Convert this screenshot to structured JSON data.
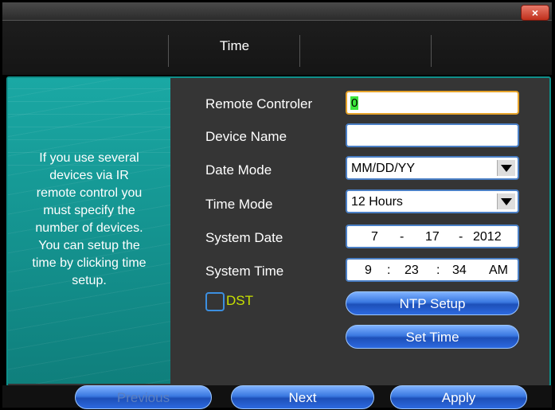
{
  "window": {
    "close_label": "×"
  },
  "tabs": [
    {
      "label": ""
    },
    {
      "label": "Time"
    },
    {
      "label": ""
    },
    {
      "label": ""
    }
  ],
  "help_text": "If you use several\ndevices via IR\nremote control you\nmust specify the\nnumber of devices.\nYou can setup the\ntime by clicking time\nsetup.",
  "fields": {
    "remote_controler": {
      "label": "Remote Controler",
      "value": "0"
    },
    "device_name": {
      "label": "Device Name",
      "value": ""
    },
    "date_mode": {
      "label": "Date Mode",
      "value": "MM/DD/YY"
    },
    "time_mode": {
      "label": "Time Mode",
      "value": "12 Hours"
    },
    "system_date": {
      "label": "System Date",
      "month": "7",
      "sep1": "-",
      "day": "17",
      "sep2": "-",
      "year": "2012"
    },
    "system_time": {
      "label": "System Time",
      "hour": "9",
      "sep1": ":",
      "minute": "23",
      "sep2": ":",
      "second": "34",
      "ampm": "AM"
    }
  },
  "dst": {
    "label": "DST",
    "checked": false
  },
  "buttons": {
    "ntp_setup": "NTP Setup",
    "set_time": "Set Time",
    "previous": "Previous",
    "next": "Next",
    "apply": "Apply"
  },
  "colors": {
    "accent": "#0e8f8a",
    "button": "#2d6ae0",
    "dst_text": "#c8e000",
    "focus_border": "#e6a32a"
  }
}
